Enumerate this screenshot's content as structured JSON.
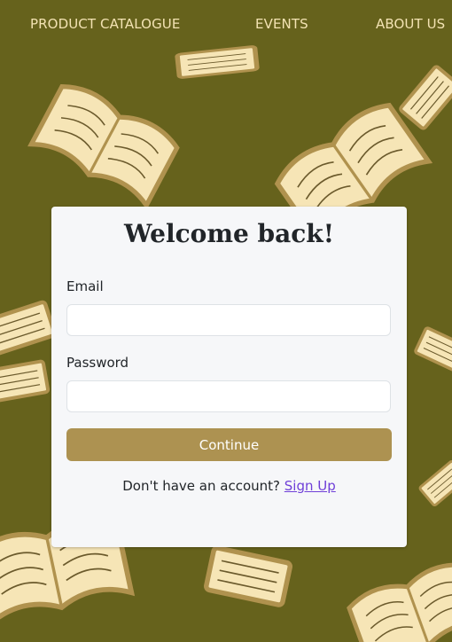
{
  "nav": {
    "items": [
      {
        "label": "PRODUCT CATALOGUE"
      },
      {
        "label": "EVENTS"
      },
      {
        "label": "ABOUT US"
      }
    ]
  },
  "login": {
    "title": "Welcome back!",
    "email_label": "Email",
    "email_value": "",
    "email_placeholder": "",
    "password_label": "Password",
    "password_value": "",
    "password_placeholder": "",
    "continue_label": "Continue",
    "signup_prompt": "Don't have an account?",
    "signup_link": "Sign Up"
  },
  "colors": {
    "background": "#66621c",
    "book_fill": "#f6e5b6",
    "book_outline": "#b0924e",
    "nav_text": "#f3e3b3",
    "card_bg": "#f6f7f9",
    "button_bg": "#ad9251",
    "link": "#6f3fd8"
  },
  "background_art": {
    "icon": "open-book-illustrations"
  }
}
